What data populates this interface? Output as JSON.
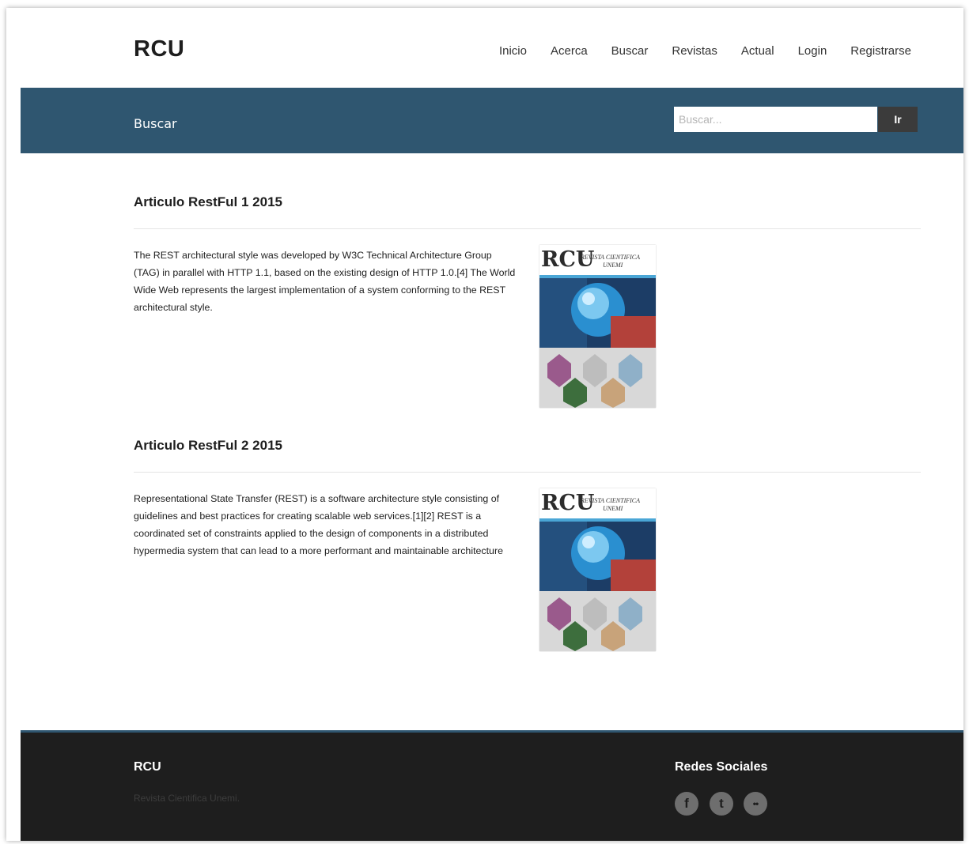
{
  "header": {
    "brand": "RCU",
    "nav": [
      "Inicio",
      "Acerca",
      "Buscar",
      "Revistas",
      "Actual",
      "Login",
      "Registrarse"
    ]
  },
  "band": {
    "title": "Buscar",
    "search_placeholder": "Buscar...",
    "search_button": "Ir"
  },
  "articles": [
    {
      "title": "Articulo RestFul 1 2015",
      "body": "The REST architectural style was developed by W3C Technical Architecture Group (TAG) in parallel with HTTP 1.1, based on the existing design of HTTP 1.0.[4] The World Wide Web represents the largest implementation of a system conforming to the REST architectural style.",
      "cover": {
        "logo": "RCU",
        "line1": "REVISTA CIENTIFICA",
        "line2": "UNEMI"
      }
    },
    {
      "title": "Articulo RestFul 2 2015",
      "body": "Representational State Transfer (REST) is a software architecture style consisting of guidelines and best practices for creating scalable web services.[1][2] REST is a coordinated set of constraints applied to the design of components in a distributed hypermedia system that can lead to a more performant and maintainable architecture",
      "cover": {
        "logo": "RCU",
        "line1": "REVISTA CIENTIFICA",
        "line2": "UNEMI"
      }
    }
  ],
  "footer": {
    "brand": "RCU",
    "subtitle": "Revista Cientifica Unemi.",
    "social_title": "Redes Sociales",
    "social": [
      {
        "icon": "facebook-icon",
        "glyph": "f"
      },
      {
        "icon": "twitter-icon",
        "glyph": "t"
      },
      {
        "icon": "flickr-icon",
        "glyph": "••"
      }
    ]
  },
  "colors": {
    "band": "#2f5670",
    "footer": "#1e1e1e",
    "button": "#3b3b3b"
  }
}
